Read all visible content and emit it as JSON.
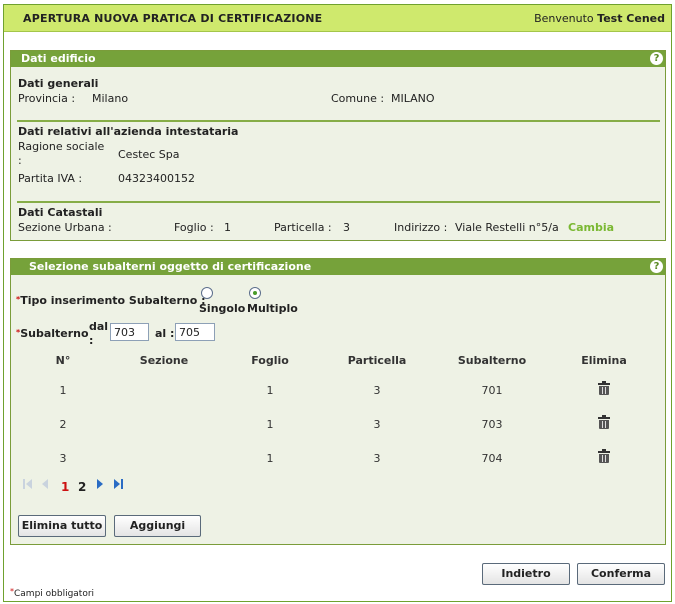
{
  "header": {
    "title": "APERTURA NUOVA PRATICA DI CERTIFICAZIONE",
    "welcome_prefix": "Benvenuto",
    "user_name": "Test Cened"
  },
  "building": {
    "title": "Dati edificio",
    "help_glyph": "?",
    "general": {
      "heading": "Dati generali",
      "province_label": "Provincia :",
      "province_value": "Milano",
      "city_label": "Comune :",
      "city_value": "MILANO"
    },
    "company": {
      "heading": "Dati relativi all'azienda intestataria",
      "name_label_1": "Ragione sociale",
      "name_label_2": ":",
      "name_value": "Cestec Spa",
      "vat_label": "Partita IVA :",
      "vat_value": "04323400152"
    },
    "cadastral": {
      "heading": "Dati Catastali",
      "section_label": "Sezione Urbana :",
      "sheet_label": "Foglio :",
      "sheet_value": "1",
      "parcel_label": "Particella :",
      "parcel_value": "3",
      "address_label": "Indirizzo :",
      "address_value": "Viale Restelli n°5/a",
      "change_link": "Cambia"
    }
  },
  "subunits": {
    "title": "Selezione subalterni oggetto di certificazione",
    "help_glyph": "?",
    "required_mark": "*",
    "type_label": "Tipo inserimento Subalterno :",
    "option_single": "Singolo",
    "option_multiple": "Multiplo",
    "selected_option": "Multiplo",
    "sub_label": "Subalterno",
    "from_label_1": "dal",
    "from_label_2": ":",
    "from_value": "703",
    "to_label": "al :",
    "to_value": "705",
    "table": {
      "headers": [
        "N°",
        "Sezione",
        "Foglio",
        "Particella",
        "Subalterno",
        "Elimina"
      ],
      "rows": [
        {
          "n": "1",
          "sezione": "",
          "foglio": "1",
          "particella": "3",
          "subalterno": "701"
        },
        {
          "n": "2",
          "sezione": "",
          "foglio": "1",
          "particella": "3",
          "subalterno": "703"
        },
        {
          "n": "3",
          "sezione": "",
          "foglio": "1",
          "particella": "3",
          "subalterno": "704"
        }
      ]
    },
    "pager": {
      "pages": [
        "1",
        "2"
      ],
      "current_page": "1"
    },
    "delete_all_label": "Elimina tutto",
    "add_label": "Aggiungi"
  },
  "actions": {
    "back_label": "Indietro",
    "confirm_label": "Conferma"
  },
  "footer": {
    "required_mark": "*",
    "required_note": "Campi obbligatori"
  },
  "colors": {
    "header_bg": "#cfe96d",
    "panel_head_bg": "#76a23a",
    "panel_bg": "#eef2e5",
    "link_green": "#7ab832",
    "required_red": "#cc1111",
    "current_page_red": "#cc1111"
  }
}
